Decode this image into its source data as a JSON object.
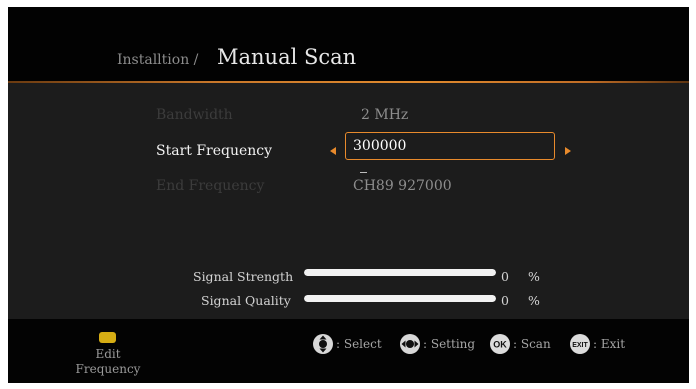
{
  "header": {
    "breadcrumb": "Installtion /",
    "title": "Manual Scan"
  },
  "settings": {
    "bandwidth": {
      "label": "Bandwidth",
      "value": "2 MHz"
    },
    "start_frequency": {
      "label": "Start Frequency",
      "value": "300000"
    },
    "end_frequency": {
      "label": "End Frequency",
      "value": "CH89  927000"
    }
  },
  "signal": {
    "strength": {
      "label": "Signal Strength",
      "value": 0,
      "number": "0",
      "unit": "%"
    },
    "quality": {
      "label": "Signal Quality",
      "value": 0,
      "number": "0",
      "unit": "%"
    }
  },
  "footer": {
    "edit_line1": "Edit",
    "edit_line2": "Frequency",
    "select": ": Select",
    "setting": ": Setting",
    "ok_key": "OK",
    "scan": ": Scan",
    "exit_key": "EXIT",
    "exit": ": Exit"
  },
  "colors": {
    "accent": "#e88a2c",
    "yellow_key": "#d6ad14"
  }
}
